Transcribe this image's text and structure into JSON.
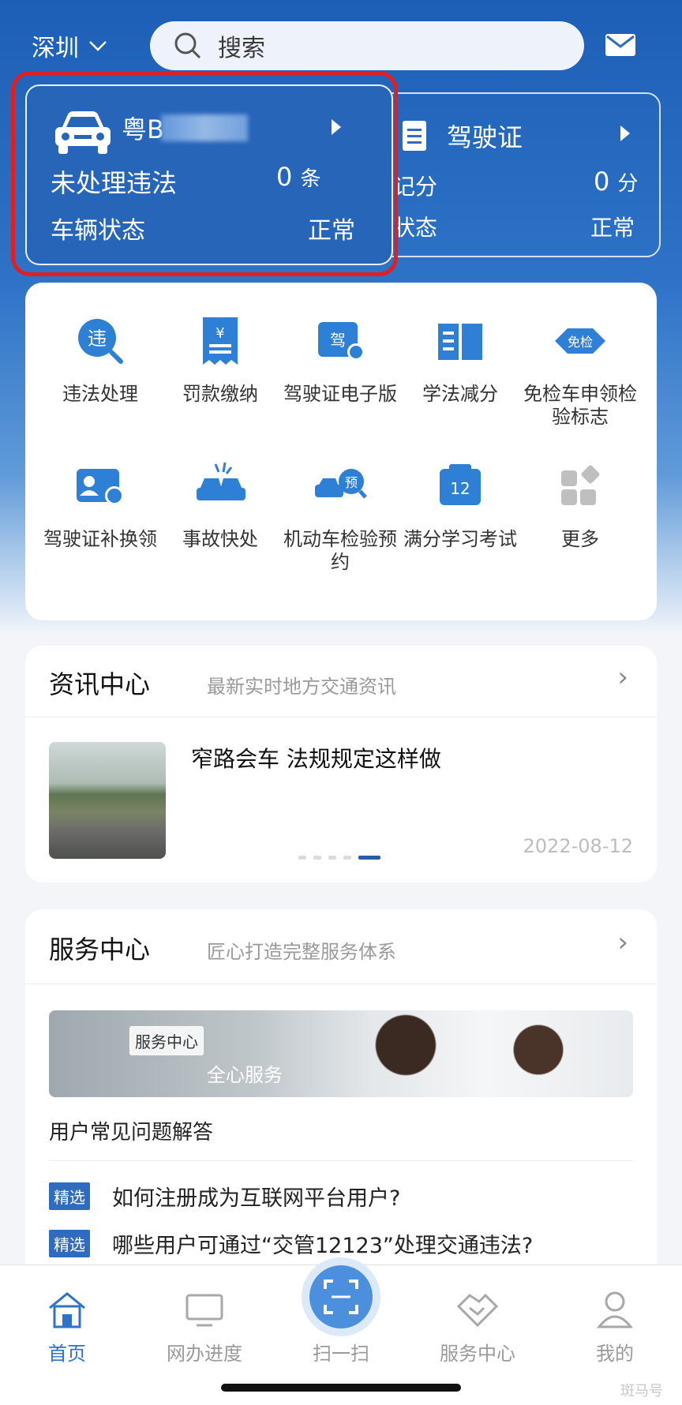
{
  "header": {
    "city": "深圳",
    "search_placeholder": "搜索"
  },
  "vehicle_card": {
    "plate": "粤B",
    "violations_label": "未处理违法",
    "violations_value": "0",
    "violations_unit": "条",
    "status_label": "车辆状态",
    "status_value": "正常"
  },
  "license_card": {
    "title": "驾驶证",
    "points_label": "积记分",
    "points_value": "0",
    "points_unit": "分",
    "status_label": "件状态",
    "status_value": "正常"
  },
  "services": [
    {
      "label": "违法处理",
      "icon": "violation-search-icon",
      "icon_text": "违"
    },
    {
      "label": "罚款缴纳",
      "icon": "fine-receipt-icon",
      "icon_text": "¥"
    },
    {
      "label": "驾驶证电子版",
      "icon": "e-license-icon",
      "icon_text": "驾"
    },
    {
      "label": "学法减分",
      "icon": "book-icon"
    },
    {
      "label": "免检车申领检验标志",
      "icon": "exempt-badge-icon",
      "icon_text": "免检"
    },
    {
      "label": "驾驶证补换领",
      "icon": "license-replace-icon"
    },
    {
      "label": "事故快处",
      "icon": "accident-icon"
    },
    {
      "label": "机动车检验预约",
      "icon": "inspection-booking-icon",
      "icon_text": "预"
    },
    {
      "label": "满分学习考试",
      "icon": "calendar-exam-icon",
      "icon_text": "12"
    },
    {
      "label": "更多",
      "icon": "more-grid-icon"
    }
  ],
  "news": {
    "title": "资讯中心",
    "subtitle": "最新实时地方交通资讯",
    "article_title": "窄路会车 法规规定这样做",
    "date": "2022-08-12"
  },
  "service_center": {
    "title": "服务中心",
    "subtitle": "匠心打造完整服务体系",
    "banner_tag": "服务中心",
    "banner_text": "全心服务",
    "faq_title": "用户常见问题解答",
    "questions": [
      {
        "tag": "精选",
        "text": "如何注册成为互联网平台用户?"
      },
      {
        "tag": "精选",
        "text": "哪些用户可通过“交管12123”处理交通违法?"
      }
    ]
  },
  "tabs": [
    {
      "label": "首页",
      "icon": "home-icon",
      "active": true
    },
    {
      "label": "网办进度",
      "icon": "monitor-icon"
    },
    {
      "label": "扫一扫",
      "icon": "scan-icon"
    },
    {
      "label": "服务中心",
      "icon": "handshake-icon"
    },
    {
      "label": "我的",
      "icon": "user-icon"
    }
  ],
  "watermark": "斑马号",
  "colors": {
    "brand_blue": "#1d5fb6",
    "highlight_red": "#e02020",
    "tag_blue": "#2f6bbf"
  }
}
